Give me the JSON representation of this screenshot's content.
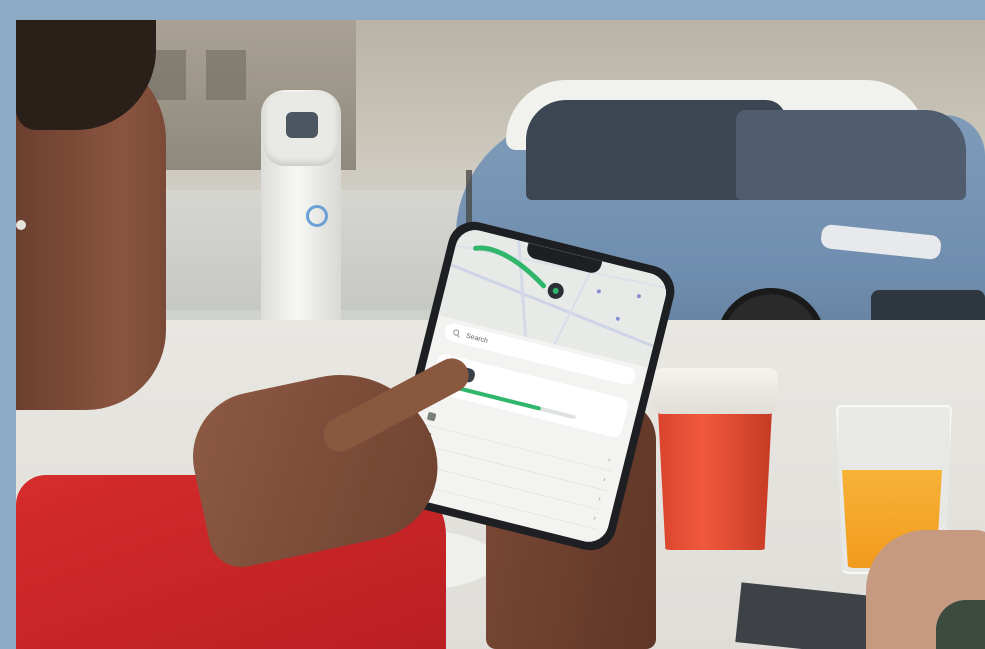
{
  "scene": {
    "description_tags": [
      "woman",
      "smartphone",
      "charging-station",
      "electric-suv",
      "coffee-cup",
      "orange-juice"
    ]
  },
  "phone_app": {
    "search_placeholder": "Search",
    "section_label": "",
    "car_name": "",
    "range_text": "",
    "battery_fraction": 0.74,
    "list_label": "",
    "list_items": [
      {
        "icon": "lock-icon",
        "label": "",
        "value": ""
      },
      {
        "icon": "fan-icon",
        "label": "",
        "value": ""
      },
      {
        "icon": "chat-icon",
        "label": "",
        "value": ""
      },
      {
        "icon": "battery-icon",
        "label": "",
        "value": ""
      }
    ]
  },
  "colors": {
    "accent_green": "#2fb66a",
    "car_blue": "#6f8dae",
    "sweater_red": "#c92525",
    "cup_red": "#e24a31",
    "juice_orange": "#f4a72b"
  }
}
